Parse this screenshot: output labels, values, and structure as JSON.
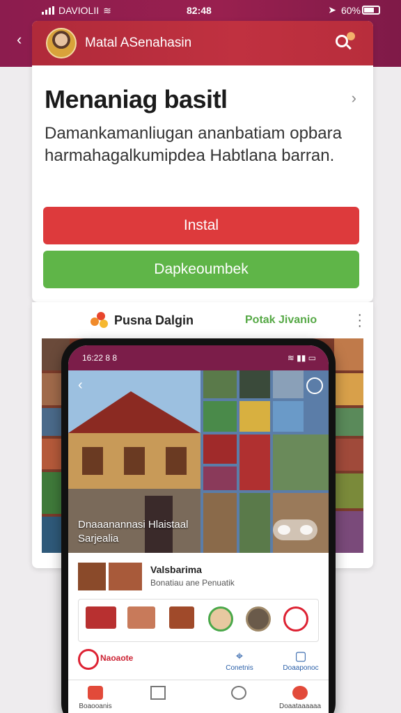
{
  "status_bar": {
    "carrier": "DAVIOLII",
    "time": "82:48",
    "battery": "60%"
  },
  "header": {
    "title": "Matal ASenahasin",
    "avatar_icon": "user-avatar",
    "action_icon": "search-icon"
  },
  "main": {
    "heading": "Menaniag basitl",
    "description": "Damankamanliugan ananbatiam opbara harmahagalkumipdea Habtlana barran.",
    "install_button": "Instal",
    "secondary_button": "Dapkeoumbek"
  },
  "source_card": {
    "brand": "Pusna Dalgin",
    "link": "Potak Jivanio",
    "more_icon": "more-vertical-icon"
  },
  "phone": {
    "status_time": "16:22 8 8",
    "caption_line1": "Dnaaanannasi Hlaistaal",
    "caption_line2": "Sarjealia",
    "item_title": "Valsbarima",
    "item_subtitle": "Bonatiau ane Penuatik",
    "brand_text": "Naoaote",
    "action1_label": "Conetnis",
    "action2_label": "Doaaponoc",
    "tabs": [
      {
        "label": "Boaooanis",
        "icon": "store-icon"
      },
      {
        "label": "",
        "icon": "home-icon"
      },
      {
        "label": "",
        "icon": "search-icon"
      },
      {
        "label": "Doaataaaaaa",
        "icon": "profile-icon"
      }
    ]
  },
  "colors": {
    "accent_red": "#dd3a3c",
    "accent_green": "#5fb548",
    "brand_maroon": "#8c1c4e"
  }
}
